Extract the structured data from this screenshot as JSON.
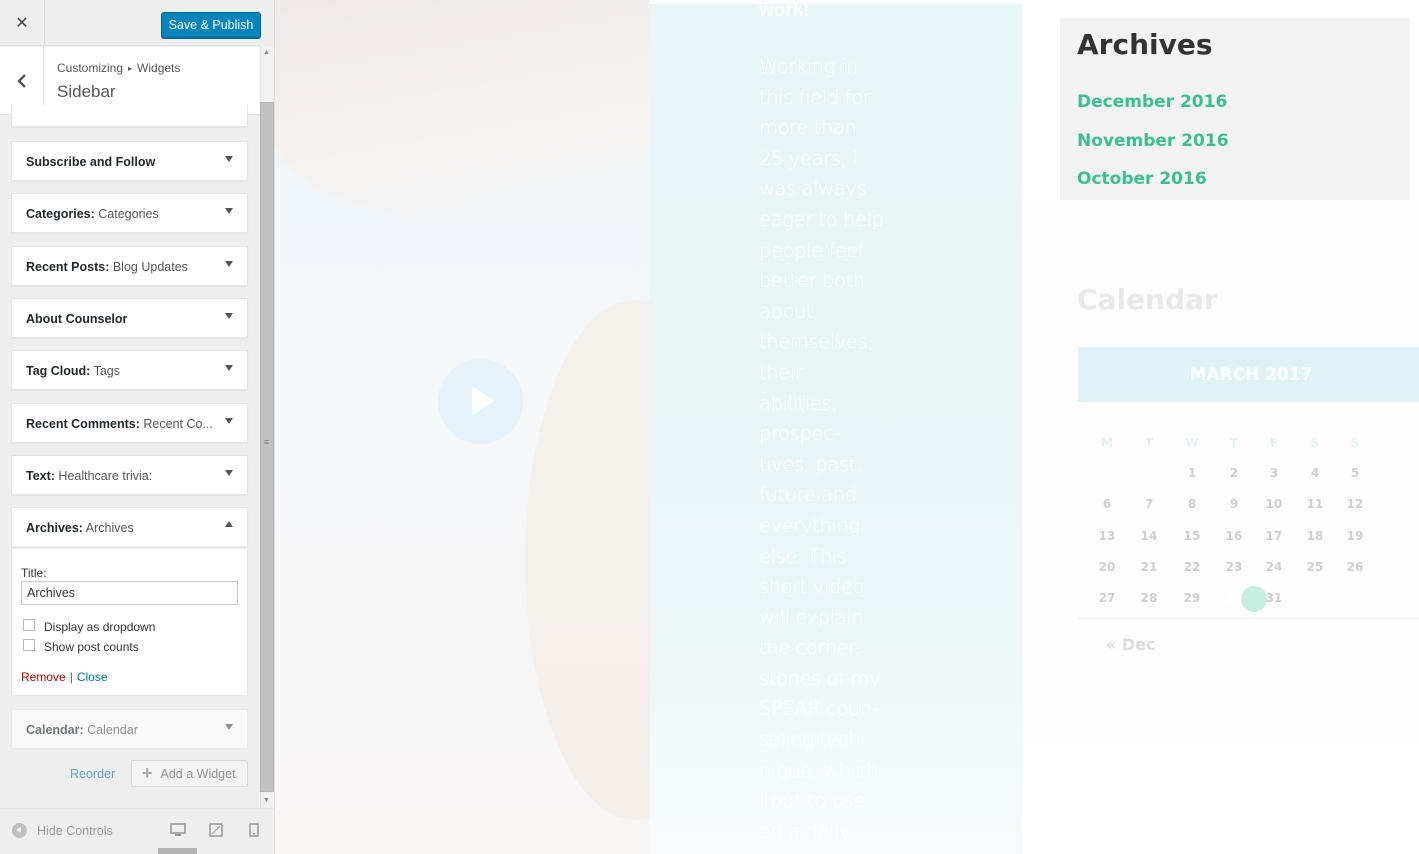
{
  "panel": {
    "save_label": "Save & Publish",
    "close_icon": "close-icon",
    "breadcrumb_root": "Customizing",
    "breadcrumb_sep": "▸",
    "breadcrumb_section": "Widgets",
    "section_title": "Sidebar"
  },
  "widgets": [
    {
      "name": "Subscribe and Follow",
      "sub": ""
    },
    {
      "name": "Categories:",
      "sub": "Categories"
    },
    {
      "name": "Recent Posts:",
      "sub": "Blog Updates"
    },
    {
      "name": "About Counselor",
      "sub": ""
    },
    {
      "name": "Tag Cloud:",
      "sub": "Tags"
    },
    {
      "name": "Recent Comments:",
      "sub": "Recent Co..."
    },
    {
      "name": "Text:",
      "sub": "Healthcare trivia:"
    },
    {
      "name": "Archives:",
      "sub": "Archives"
    },
    {
      "name": "Calendar:",
      "sub": "Calendar"
    }
  ],
  "archives_form": {
    "title_label": "Title:",
    "title_value": "Archives",
    "dropdown_label": "Display as dropdown",
    "dropdown_checked": false,
    "counts_label": "Show post counts",
    "counts_checked": false,
    "remove_label": "Remove",
    "separator": "|",
    "close_label": "Close"
  },
  "panel_footer": {
    "reorder_label": "Reorder",
    "add_widget_label": "Add a Widget",
    "hide_controls_label": "Hide Controls"
  },
  "preview": {
    "video_heading_tail": "work!",
    "video_text": "Working in this field for more than 25 years, I was always eager to help people feel better both about themselves, their abilities, prospec-tives, past, future and everything else. This short video will explain the corner-stones of my SPEAR coun-seling tech-nique, which I put to use on a daily basis to help",
    "archives": {
      "title": "Archives",
      "links": [
        "December 2016",
        "November 2016",
        "October 2016"
      ]
    },
    "calendar": {
      "title": "Calendar",
      "month": "MARCH 2017",
      "weekdays": [
        "M",
        "T",
        "W",
        "T",
        "F",
        "S",
        "S"
      ],
      "weeks": [
        [
          "",
          "",
          "1",
          "2",
          "3",
          "4",
          "5"
        ],
        [
          "6",
          "7",
          "8",
          "9",
          "10",
          "11",
          "12"
        ],
        [
          "13",
          "14",
          "15",
          "16",
          "17",
          "18",
          "19"
        ],
        [
          "20",
          "21",
          "22",
          "23",
          "24",
          "25",
          "26"
        ],
        [
          "27",
          "28",
          "29",
          "30",
          "31",
          "",
          ""
        ]
      ],
      "today": "30",
      "prev_link": "« Dec"
    }
  },
  "colors": {
    "primary_button": "#0085ba",
    "link": "#0073aa",
    "remove": "#aa0000",
    "archive_link": "#3bbf8f"
  }
}
